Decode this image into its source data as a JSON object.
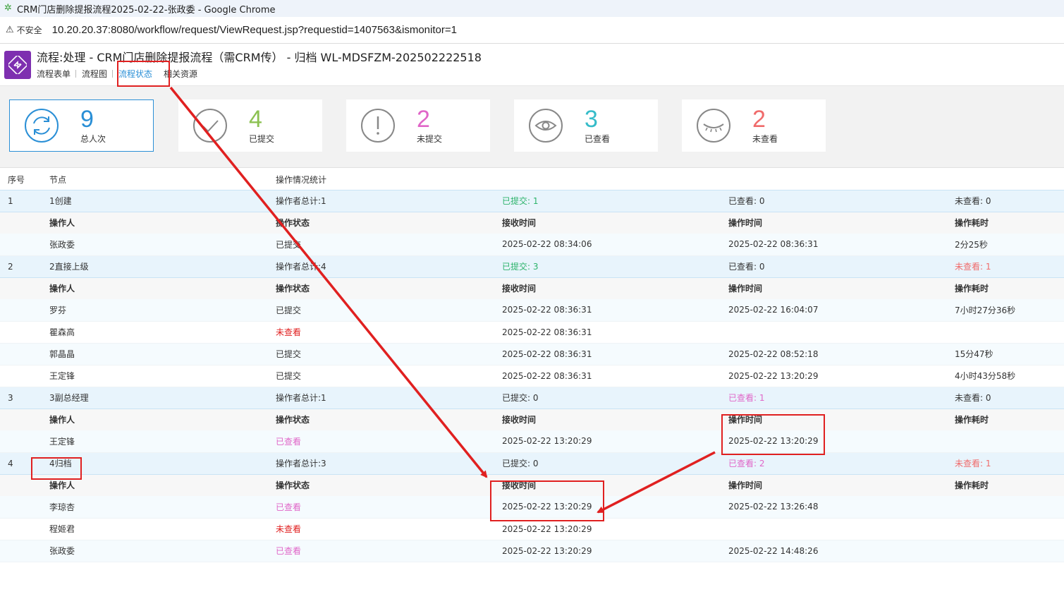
{
  "browser": {
    "window_title": "CRM门店删除提报流程2025-02-22-张政委 - Google Chrome",
    "security_label": "不安全",
    "url": "10.20.20.37:8080/workflow/request/ViewRequest.jsp?requestid=1407563&ismonitor=1"
  },
  "header": {
    "title": "流程:处理 - CRM门店删除提报流程（需CRM传） - 归档 WL-MDSFZM-202502222518",
    "tabs": [
      "流程表单",
      "流程图",
      "流程状态",
      "相关资源"
    ],
    "active_tab": "流程状态"
  },
  "stats": [
    {
      "value": "9",
      "label": "总人次",
      "color": "#2a8fd6",
      "icon": "refresh-icon"
    },
    {
      "value": "4",
      "label": "已提交",
      "color": "#8cc152",
      "icon": "check-icon"
    },
    {
      "value": "2",
      "label": "未提交",
      "color": "#e066c8",
      "icon": "exclamation-icon"
    },
    {
      "value": "3",
      "label": "已查看",
      "color": "#36bcc9",
      "icon": "eye-icon"
    },
    {
      "value": "2",
      "label": "未查看",
      "color": "#f06b6b",
      "icon": "eye-closed-icon"
    }
  ],
  "table": {
    "headers": [
      "序号",
      "节点",
      "操作情况统计"
    ],
    "sub_headers": [
      "操作人",
      "操作状态",
      "接收时间",
      "操作时间",
      "操作耗时"
    ],
    "nodes": [
      {
        "index": "1",
        "name": "1创建",
        "total": "操作者总计:1",
        "submitted": "已提交: 1",
        "viewed": "已查看: 0",
        "unviewed": "未查看: 0",
        "operators": [
          {
            "name": "张政委",
            "status": "已提交",
            "received": "2025-02-22 08:34:06",
            "operated": "2025-02-22 08:36:31",
            "duration": "2分25秒"
          }
        ]
      },
      {
        "index": "2",
        "name": "2直接上级",
        "total": "操作者总计:4",
        "submitted": "已提交: 3",
        "viewed": "已查看: 0",
        "unviewed": "未查看: 1",
        "operators": [
          {
            "name": "罗芬",
            "status": "已提交",
            "received": "2025-02-22 08:36:31",
            "operated": "2025-02-22 16:04:07",
            "duration": "7小时27分36秒"
          },
          {
            "name": "瞿森高",
            "status": "未查看",
            "received": "2025-02-22 08:36:31",
            "operated": "",
            "duration": ""
          },
          {
            "name": "郭晶晶",
            "status": "已提交",
            "received": "2025-02-22 08:36:31",
            "operated": "2025-02-22 08:52:18",
            "duration": "15分47秒"
          },
          {
            "name": "王定锋",
            "status": "已提交",
            "received": "2025-02-22 08:36:31",
            "operated": "2025-02-22 13:20:29",
            "duration": "4小时43分58秒"
          }
        ]
      },
      {
        "index": "3",
        "name": "3副总经理",
        "total": "操作者总计:1",
        "submitted": "已提交: 0",
        "viewed": "已查看: 1",
        "unviewed": "未查看: 0",
        "operators": [
          {
            "name": "王定锋",
            "status": "已查看",
            "received": "2025-02-22 13:20:29",
            "operated": "2025-02-22 13:20:29",
            "duration": ""
          }
        ]
      },
      {
        "index": "4",
        "name": "4归档",
        "total": "操作者总计:3",
        "submitted": "已提交: 0",
        "viewed": "已查看: 2",
        "unviewed": "未查看: 1",
        "operators": [
          {
            "name": "李琼杏",
            "status": "已查看",
            "received": "2025-02-22 13:20:29",
            "operated": "2025-02-22 13:26:48",
            "duration": ""
          },
          {
            "name": "程姬君",
            "status": "未查看",
            "received": "2025-02-22 13:20:29",
            "operated": "",
            "duration": ""
          },
          {
            "name": "张政委",
            "status": "已查看",
            "received": "2025-02-22 13:20:29",
            "operated": "2025-02-22 14:48:26",
            "duration": ""
          }
        ]
      }
    ]
  }
}
